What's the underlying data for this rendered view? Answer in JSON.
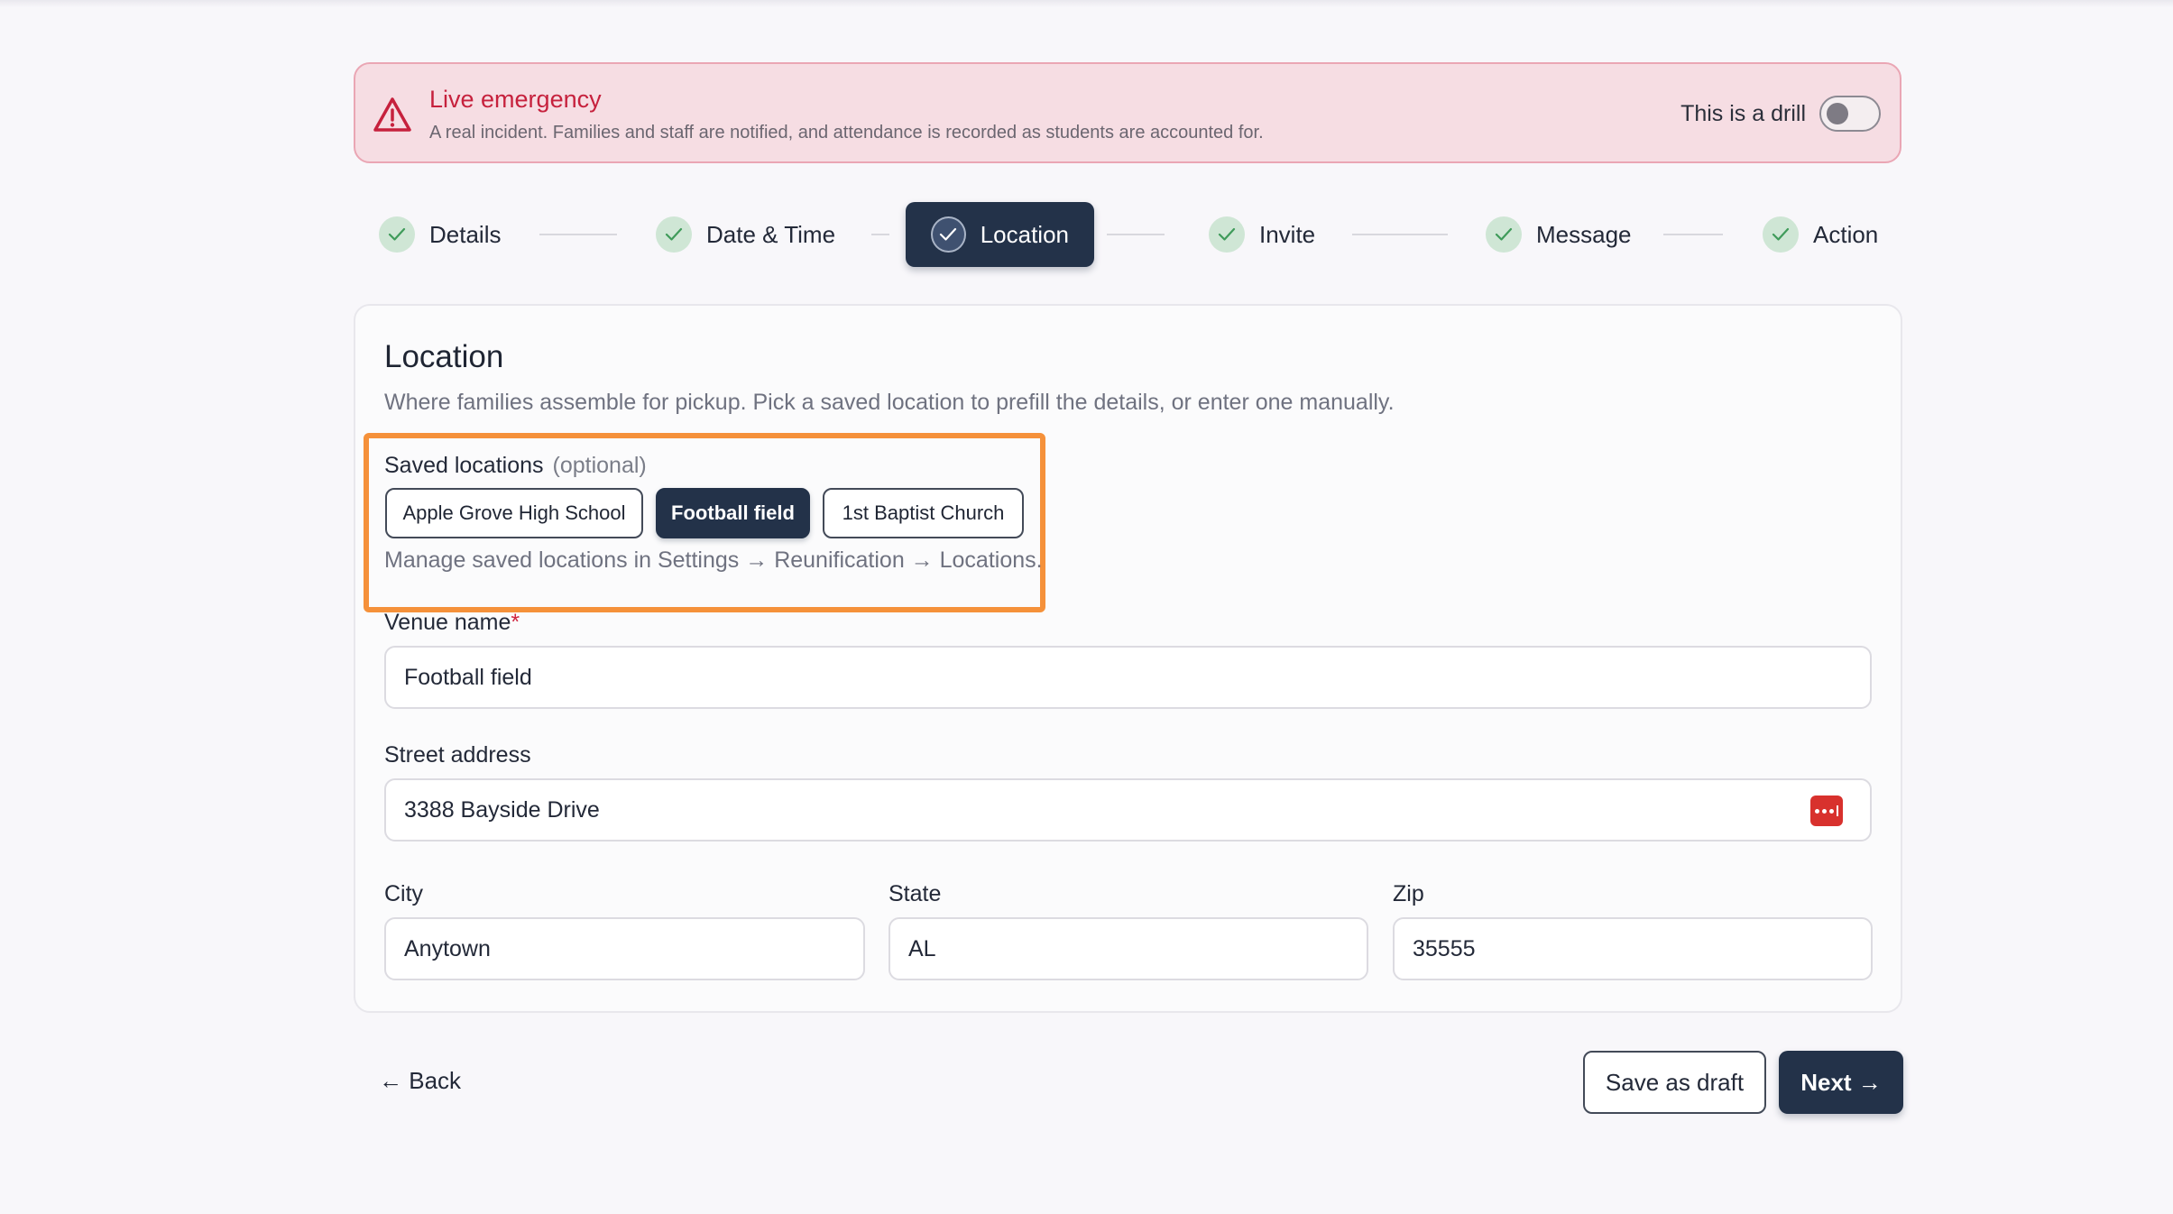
{
  "banner": {
    "title": "Live emergency",
    "subtitle": "A real incident. Families and staff are notified, and attendance is recorded as students are accounted for.",
    "drill_label": "This is a drill",
    "drill_enabled": false,
    "icon": "warning-triangle-icon"
  },
  "stepper": {
    "steps": [
      {
        "label": "Details",
        "status": "complete"
      },
      {
        "label": "Date & Time",
        "status": "complete"
      },
      {
        "label": "Location",
        "status": "current"
      },
      {
        "label": "Invite",
        "status": "complete"
      },
      {
        "label": "Message",
        "status": "complete"
      },
      {
        "label": "Action",
        "status": "complete"
      }
    ]
  },
  "location": {
    "title": "Location",
    "description": "Where families assemble for pickup. Pick a saved location to prefill the details, or enter one manually.",
    "saved_label": "Saved locations",
    "saved_optional": "(optional)",
    "saved_options": [
      "Apple Grove High School",
      "Football field",
      "1st Baptist Church"
    ],
    "selected_option": "Football field",
    "manage_hint": "Manage saved locations in Settings → Reunification → Locations.",
    "venue_label": "Venue name",
    "required_mark": "*",
    "venue_value": "Football field",
    "street_label": "Street address",
    "street_value": "3388 Bayside Drive",
    "city_label": "City",
    "city_value": "Anytown",
    "state_label": "State",
    "state_value": "AL",
    "zip_label": "Zip",
    "zip_value": "35555"
  },
  "footer": {
    "back_label": "← Back",
    "draft_label": "Save as draft",
    "next_label": "Next →"
  },
  "colors": {
    "primary": "#233249",
    "danger": "#c6213d",
    "banner_bg": "#f6dde3",
    "highlight": "#f5913a",
    "check_bg": "#cfe6d5"
  }
}
